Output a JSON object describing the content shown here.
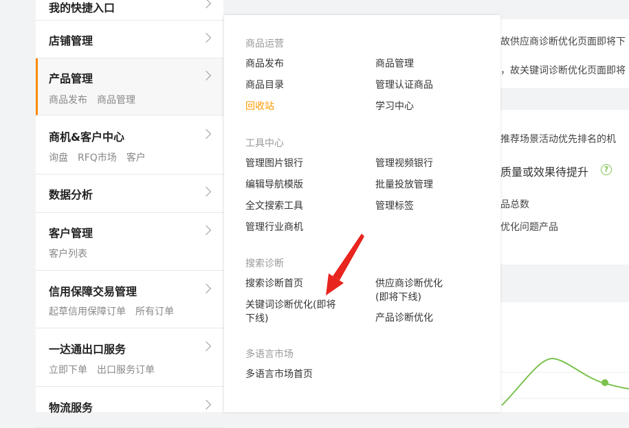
{
  "background": {
    "line1": "故供应商诊断优化页面即将下",
    "line2": "，故关键词诊断优化页面即将",
    "line3": "推荐场景活动优先排名的机",
    "line4": "质量或效果待提升",
    "line5": "品总数",
    "line6": "优化问题产品"
  },
  "sidebar": {
    "items": [
      {
        "title": "我的快捷入口",
        "subs": []
      },
      {
        "title": "店铺管理",
        "subs": []
      },
      {
        "title": "产品管理",
        "subs": [
          "商品发布",
          "商品管理"
        ]
      },
      {
        "title": "商机&客户中心",
        "subs": [
          "询盘",
          "RFQ市场",
          "客户"
        ]
      },
      {
        "title": "数据分析",
        "subs": []
      },
      {
        "title": "客户管理",
        "subs": [
          "客户列表"
        ]
      },
      {
        "title": "信用保障交易管理",
        "subs": [
          "起草信用保障订单",
          "所有订单"
        ]
      },
      {
        "title": "一达通出口服务",
        "subs": [
          "立即下单",
          "出口服务订单"
        ]
      },
      {
        "title": "物流服务",
        "subs": []
      }
    ]
  },
  "flyout": {
    "groups": [
      {
        "title": "商品运营",
        "links": [
          "商品发布",
          "商品管理",
          "商品目录",
          "管理认证商品",
          "回收站",
          "学习中心"
        ]
      },
      {
        "title": "工具中心",
        "links": [
          "管理图片银行",
          "管理视频银行",
          "编辑导航模版",
          "批量投放管理",
          "全文搜索工具",
          "管理标签",
          "管理行业商机"
        ]
      },
      {
        "title": "搜索诊断",
        "links": [
          "搜索诊断首页",
          "供应商诊断优化\n(即将下线)",
          "关键词诊断优化(即将\n下线)",
          "产品诊断优化"
        ]
      },
      {
        "title": "多语言市场",
        "links": [
          "多语言市场首页"
        ]
      }
    ]
  },
  "colors": {
    "accent": "#ff8a00",
    "highlight_link": "#ff9a00",
    "chart_line": "#7ac24d",
    "annotation_arrow": "#e8251e"
  }
}
